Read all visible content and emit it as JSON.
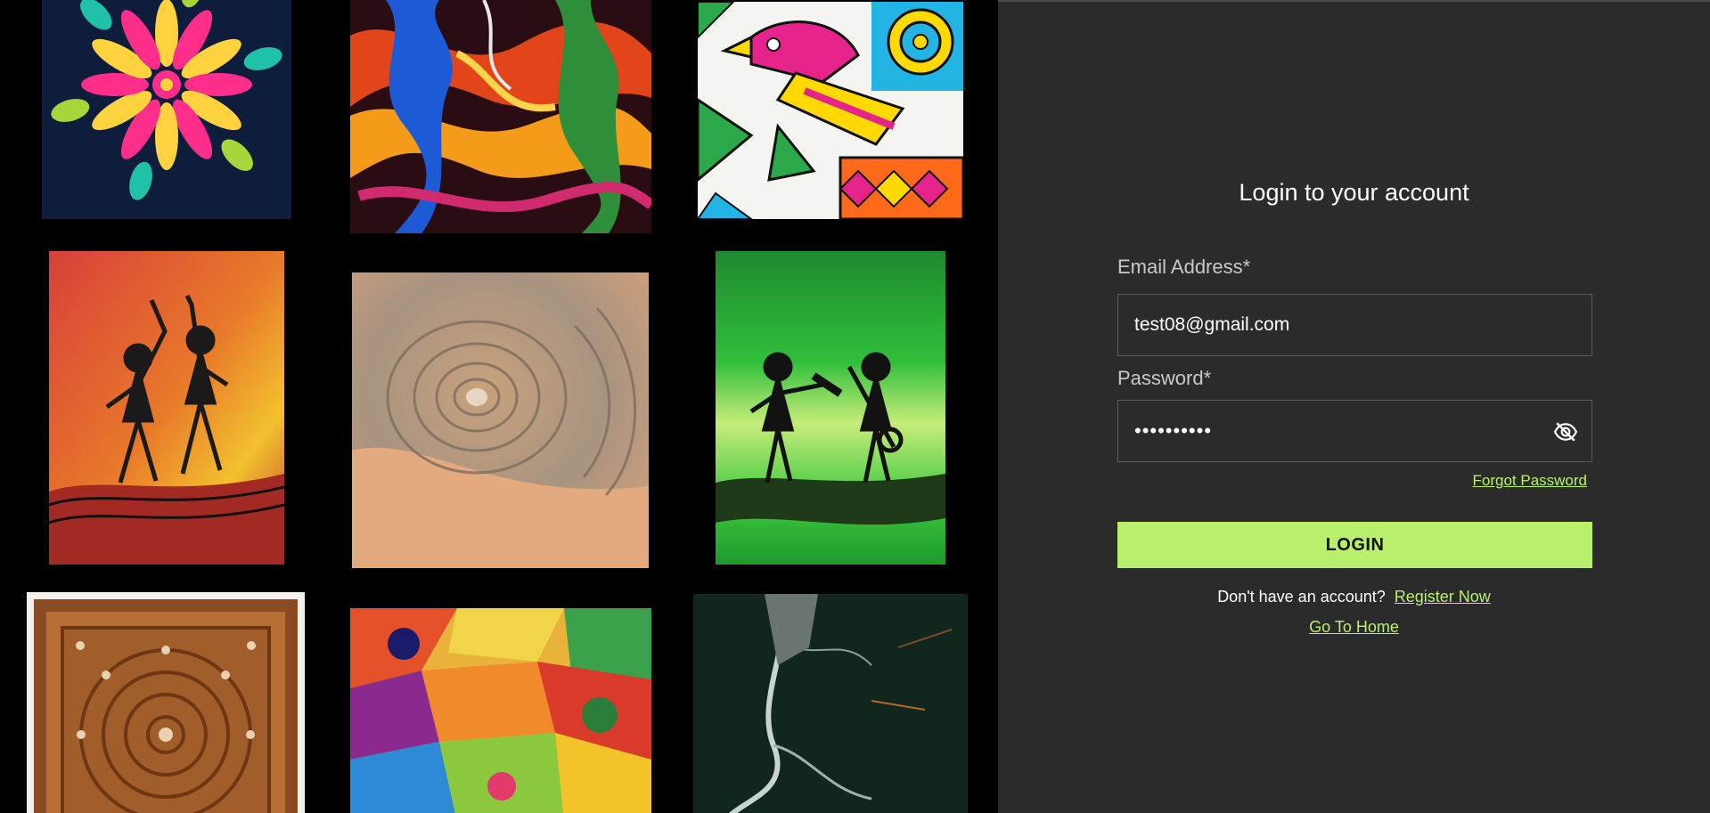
{
  "gallery": {
    "items": [
      {
        "icon": "mandala-flower-art"
      },
      {
        "icon": "abstract-swirl-art"
      },
      {
        "icon": "folk-bird-art"
      },
      {
        "icon": "warli-dancers-red-art"
      },
      {
        "icon": "desert-crater-art"
      },
      {
        "icon": "warli-musicians-green-art"
      },
      {
        "icon": "carved-wood-panel-art"
      },
      {
        "icon": "colorful-impasto-art"
      },
      {
        "icon": "dark-marble-art"
      }
    ]
  },
  "login": {
    "title": "Login to your account",
    "email_label": "Email Address*",
    "email_value": "test08@gmail.com",
    "password_label": "Password*",
    "password_value": "••••••••••",
    "forgot_label": "Forgot Password",
    "login_button": "LOGIN",
    "no_account_text": "Don't have an account?",
    "register_label": "Register Now",
    "home_label": "Go To Home"
  },
  "colors": {
    "accent": "#b8f06e",
    "panel_bg": "#2b2b2b",
    "gallery_bg": "#000000"
  }
}
